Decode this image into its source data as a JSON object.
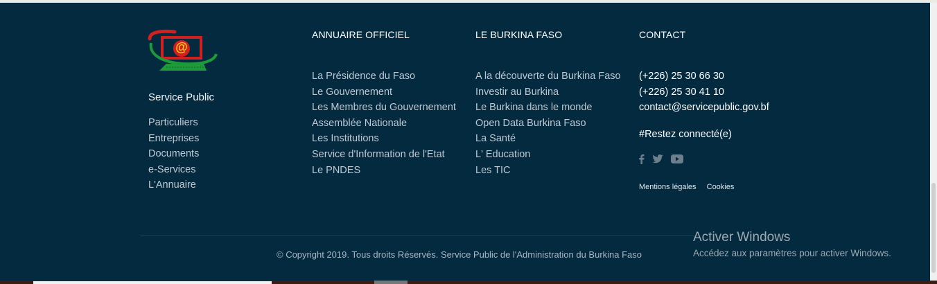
{
  "brand": {
    "logo_text": "@",
    "name": "Service Public"
  },
  "service_links": [
    "Particuliers",
    "Entreprises",
    "Documents",
    "e-Services",
    "L'Annuaire"
  ],
  "annuaire": {
    "title": "ANNUAIRE OFFICIEL",
    "links": [
      "La Présidence du Faso",
      "Le Gouvernement",
      "Les Membres du Gouvernement",
      "Assemblée Nationale",
      "Les Institutions",
      "Service d'Information de l'Etat",
      "Le PNDES"
    ]
  },
  "burkina": {
    "title": "LE BURKINA FASO",
    "links": [
      "A la découverte du Burkina Faso",
      "Investir au Burkina",
      "Le Burkina dans le monde",
      "Open Data Burkina Faso",
      "La Santé",
      "L' Education",
      "Les TIC"
    ]
  },
  "contact": {
    "title": "CONTACT",
    "lines": [
      "(+226) 25 30 66 30",
      "(+226) 25 30 41 10",
      "contact@servicepublic.gov.bf"
    ],
    "hashtag": "#Restez connecté(e)",
    "social_icons": [
      "facebook-icon",
      "twitter-icon",
      "youtube-icon"
    ],
    "legal": [
      "Mentions légales",
      "Cookies"
    ]
  },
  "copyright": "© Copyright 2019. Tous droits Réservés. Service Public de l'Administration du Burkina Faso",
  "watermark": {
    "title": "Activer Windows",
    "subtitle": "Accédez aux paramètres pour activer Windows."
  },
  "colors": {
    "footer_bg": "#032a3f",
    "link": "#bfc9d2",
    "heading": "#ffffff",
    "logo_red": "#d21f1f",
    "logo_green": "#1e9a3a",
    "logo_yellow": "#f4d21a"
  }
}
